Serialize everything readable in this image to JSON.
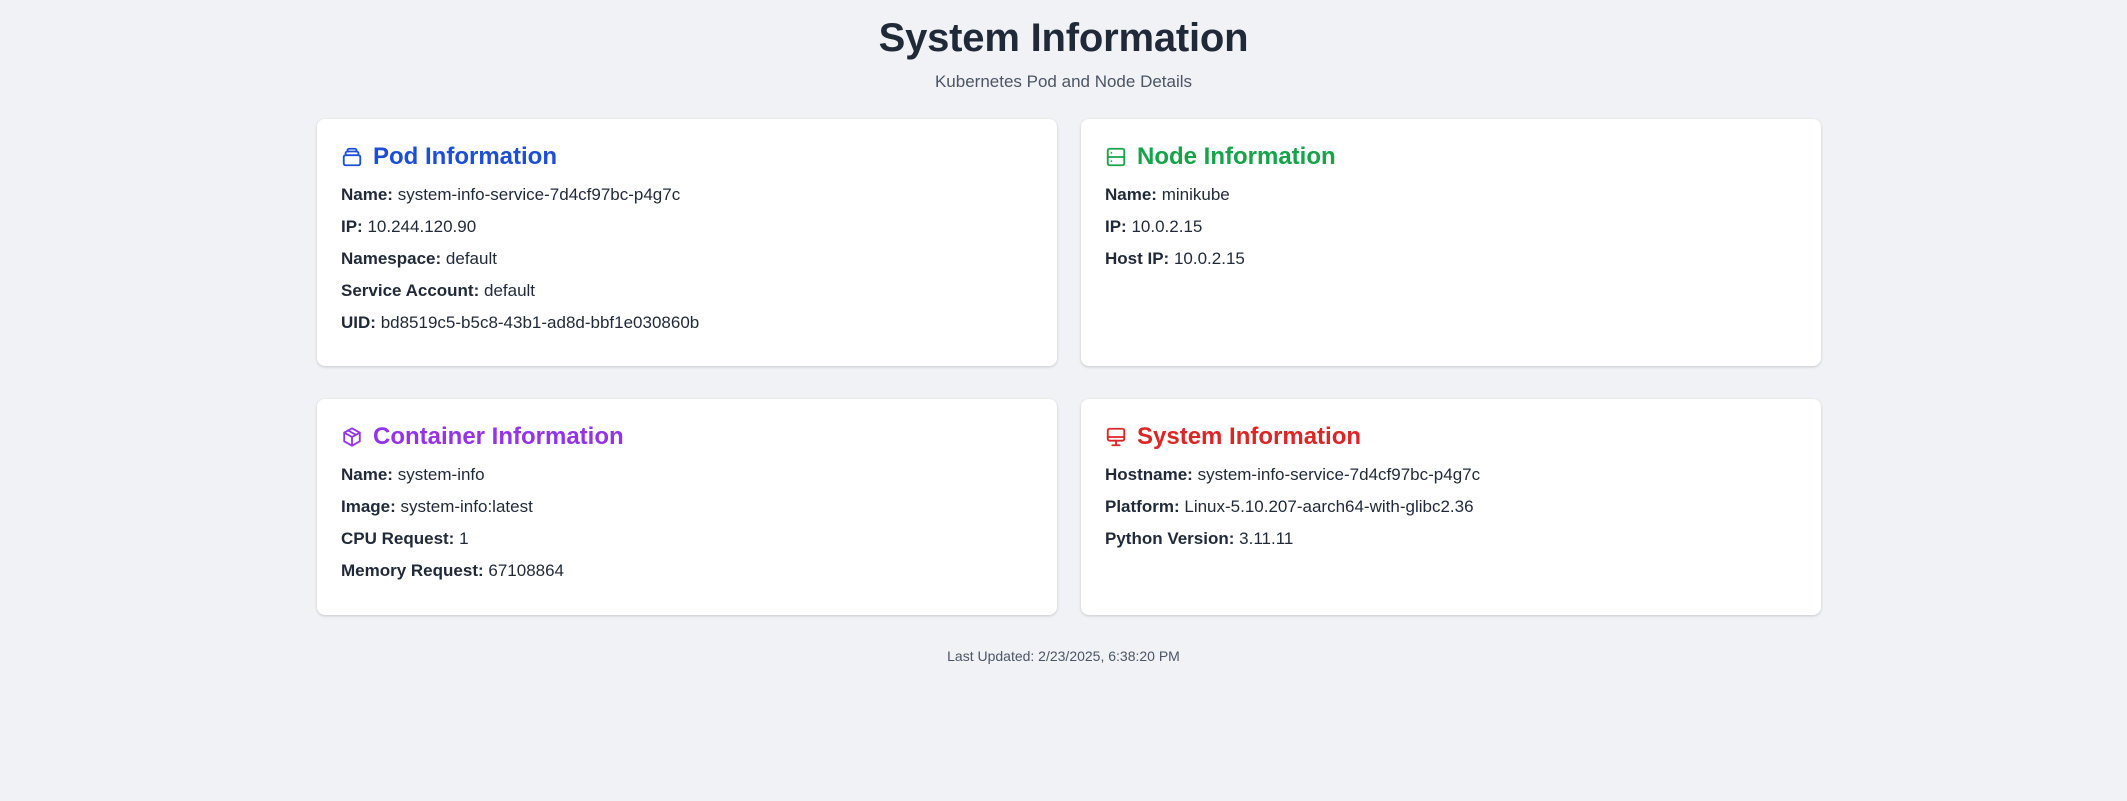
{
  "header": {
    "title": "System Information",
    "subtitle": "Kubernetes Pod and Node Details"
  },
  "colors": {
    "pod": "#1d4ed8",
    "node": "#16a34a",
    "container": "#9333ea",
    "system": "#dc2626"
  },
  "pod": {
    "title": "Pod Information",
    "icon": "layers-icon",
    "fields": [
      {
        "label": "Name:",
        "value": "system-info-service-7d4cf97bc-p4g7c"
      },
      {
        "label": "IP:",
        "value": "10.244.120.90"
      },
      {
        "label": "Namespace:",
        "value": "default"
      },
      {
        "label": "Service Account:",
        "value": "default"
      },
      {
        "label": "UID:",
        "value": "bd8519c5-b5c8-43b1-ad8d-bbf1e030860b"
      }
    ]
  },
  "node": {
    "title": "Node Information",
    "icon": "server-icon",
    "fields": [
      {
        "label": "Name:",
        "value": "minikube"
      },
      {
        "label": "IP:",
        "value": "10.0.2.15"
      },
      {
        "label": "Host IP:",
        "value": "10.0.2.15"
      }
    ]
  },
  "container": {
    "title": "Container Information",
    "icon": "box-icon",
    "fields": [
      {
        "label": "Name:",
        "value": "system-info"
      },
      {
        "label": "Image:",
        "value": "system-info:latest"
      },
      {
        "label": "CPU Request:",
        "value": "1"
      },
      {
        "label": "Memory Request:",
        "value": "67108864"
      }
    ]
  },
  "system": {
    "title": "System Information",
    "icon": "monitor-icon",
    "fields": [
      {
        "label": "Hostname:",
        "value": "system-info-service-7d4cf97bc-p4g7c"
      },
      {
        "label": "Platform:",
        "value": "Linux-5.10.207-aarch64-with-glibc2.36"
      },
      {
        "label": "Python Version:",
        "value": "3.11.11"
      }
    ]
  },
  "footer": {
    "last_updated": "Last Updated: 2/23/2025, 6:38:20 PM"
  }
}
